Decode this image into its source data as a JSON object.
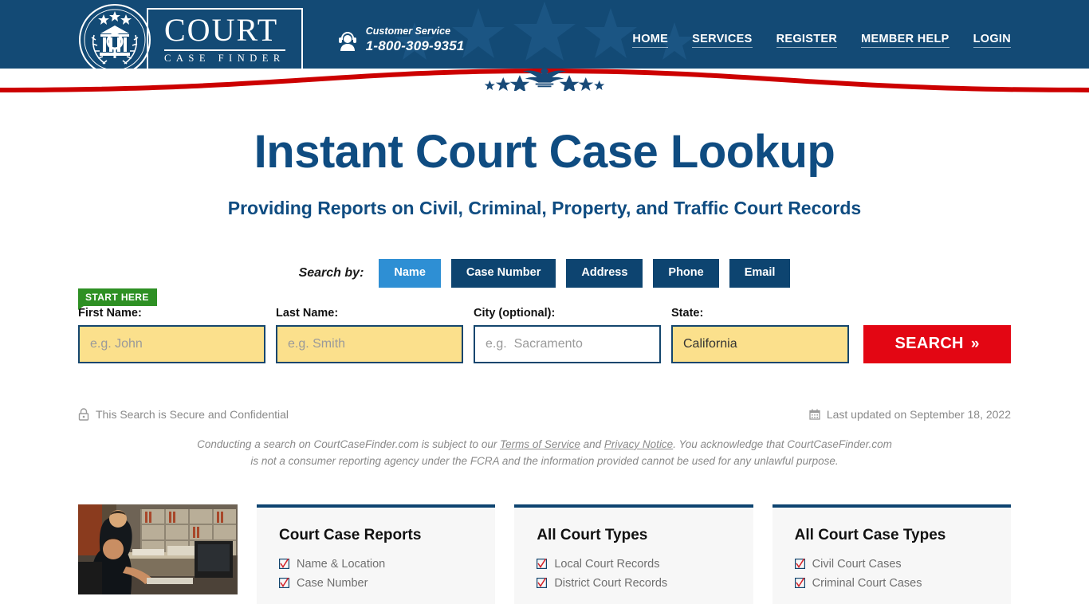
{
  "header": {
    "logo": {
      "seal_icon": "courthouse-seal-icon",
      "title": "COURT",
      "subtitle": "CASE FINDER"
    },
    "customer_service": {
      "icon": "headset-support-icon",
      "label": "Customer Service",
      "phone": "1-800-309-9351"
    },
    "nav": [
      {
        "label": "HOME"
      },
      {
        "label": "SERVICES"
      },
      {
        "label": "REGISTER"
      },
      {
        "label": "MEMBER HELP"
      },
      {
        "label": "LOGIN"
      }
    ],
    "colors": {
      "background": "#134a75",
      "accent_red": "#cc0000"
    },
    "eagle_icon": "eagle-emblem-icon"
  },
  "hero": {
    "title": "Instant Court Case Lookup",
    "subtitle": "Providing Reports on Civil, Criminal, Property, and Traffic Court Records",
    "title_color": "#0f4c81"
  },
  "search_by": {
    "label": "Search by:",
    "tabs": [
      {
        "label": "Name",
        "active": true
      },
      {
        "label": "Case Number",
        "active": false
      },
      {
        "label": "Address",
        "active": false
      },
      {
        "label": "Phone",
        "active": false
      },
      {
        "label": "Email",
        "active": false
      }
    ],
    "active_color": "#2e8fd4",
    "inactive_color": "#0d4470"
  },
  "form": {
    "badge": "START HERE",
    "badge_color": "#2e9024",
    "first_name": {
      "label": "First Name:",
      "placeholder": "e.g. John",
      "value": ""
    },
    "last_name": {
      "label": "Last Name:",
      "placeholder": "e.g. Smith",
      "value": ""
    },
    "city": {
      "label": "City (optional):",
      "placeholder": "e.g.  Sacramento",
      "value": ""
    },
    "state": {
      "label": "State:",
      "selected": "California"
    },
    "search_button": {
      "label": "SEARCH",
      "chevron": "»",
      "color": "#e30613"
    }
  },
  "notices": {
    "secure_icon": "lock-icon",
    "secure_text": "This Search is Secure and Confidential",
    "calendar_icon": "calendar-icon",
    "last_updated": "Last updated on September 18, 2022",
    "disclaimer_line1_a": "Conducting a search on CourtCaseFinder.com is subject to our ",
    "disclaimer_terms": "Terms of Service",
    "disclaimer_line1_b": " and ",
    "disclaimer_privacy": "Privacy Notice",
    "disclaimer_line1_c": ". You acknowledge that CourtCaseFinder.com",
    "disclaimer_line2": "is not a consumer reporting agency under the FCRA and the information provided cannot be used for any unlawful purpose."
  },
  "features": {
    "photo_alt": "officers-at-records-desk-photo",
    "cards": [
      {
        "title": "Court Case Reports",
        "items": [
          "Name & Location",
          "Case Number"
        ]
      },
      {
        "title": "All Court Types",
        "items": [
          "Local Court Records",
          "District Court Records"
        ]
      },
      {
        "title": "All Court Case Types",
        "items": [
          "Civil Court Cases",
          "Criminal Court Cases"
        ]
      }
    ],
    "check_icon": "red-checkmark-icon"
  }
}
